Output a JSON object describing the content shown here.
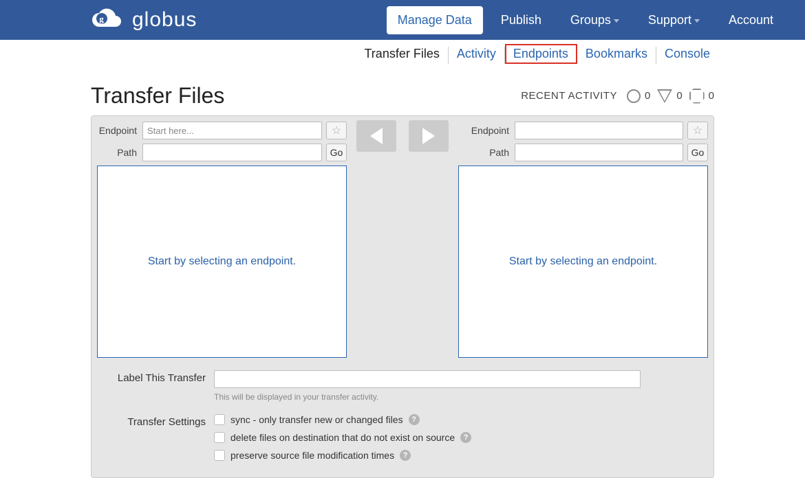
{
  "brand": "globus",
  "top_nav": {
    "manage_data": "Manage Data",
    "publish": "Publish",
    "groups": "Groups",
    "support": "Support",
    "account": "Account"
  },
  "sub_nav": {
    "transfer_files": "Transfer Files",
    "activity": "Activity",
    "endpoints": "Endpoints",
    "bookmarks": "Bookmarks",
    "console": "Console"
  },
  "page_title": "Transfer Files",
  "recent_activity": {
    "label": "RECENT ACTIVITY",
    "ok_count": "0",
    "warn_count": "0",
    "stop_count": "0"
  },
  "left_pane": {
    "endpoint_label": "Endpoint",
    "endpoint_placeholder": "Start here...",
    "endpoint_value": "",
    "path_label": "Path",
    "path_value": "",
    "go_label": "Go",
    "placeholder_text": "Start by selecting an endpoint."
  },
  "right_pane": {
    "endpoint_label": "Endpoint",
    "endpoint_placeholder": "",
    "endpoint_value": "",
    "path_label": "Path",
    "path_value": "",
    "go_label": "Go",
    "placeholder_text": "Start by selecting an endpoint."
  },
  "form": {
    "label_transfer": "Label This Transfer",
    "label_transfer_helper": "This will be displayed in your transfer activity.",
    "transfer_settings_label": "Transfer Settings",
    "settings": [
      "sync - only transfer new or changed files",
      "delete files on destination that do not exist on source",
      "preserve source file modification times"
    ]
  }
}
